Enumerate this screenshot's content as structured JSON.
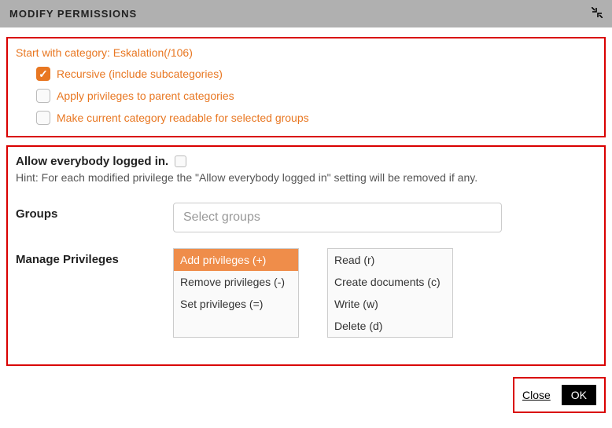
{
  "header": {
    "title": "MODIFY PERMISSIONS"
  },
  "category": {
    "start_label": "Start with category: Eskalation(/106)",
    "options": {
      "recursive": {
        "label": "Recursive (include subcategories)",
        "checked": true
      },
      "apply_parent": {
        "label": "Apply privileges to parent categories",
        "checked": false
      },
      "make_readable": {
        "label": "Make current category readable for selected groups",
        "checked": false
      }
    }
  },
  "allow": {
    "label": "Allow everybody logged in.",
    "checked": false,
    "hint": "Hint: For each modified privilege the \"Allow everybody logged in\" setting will be removed if any."
  },
  "groups": {
    "label": "Groups",
    "placeholder": "Select groups"
  },
  "privileges": {
    "label": "Manage Privileges",
    "actions": [
      {
        "label": "Add privileges (+)",
        "selected": true
      },
      {
        "label": "Remove privileges (-)",
        "selected": false
      },
      {
        "label": "Set privileges (=)",
        "selected": false
      }
    ],
    "types": [
      {
        "label": "Read (r)"
      },
      {
        "label": "Create documents (c)"
      },
      {
        "label": "Write (w)"
      },
      {
        "label": "Delete (d)"
      }
    ]
  },
  "footer": {
    "close": "Close",
    "ok": "OK"
  }
}
